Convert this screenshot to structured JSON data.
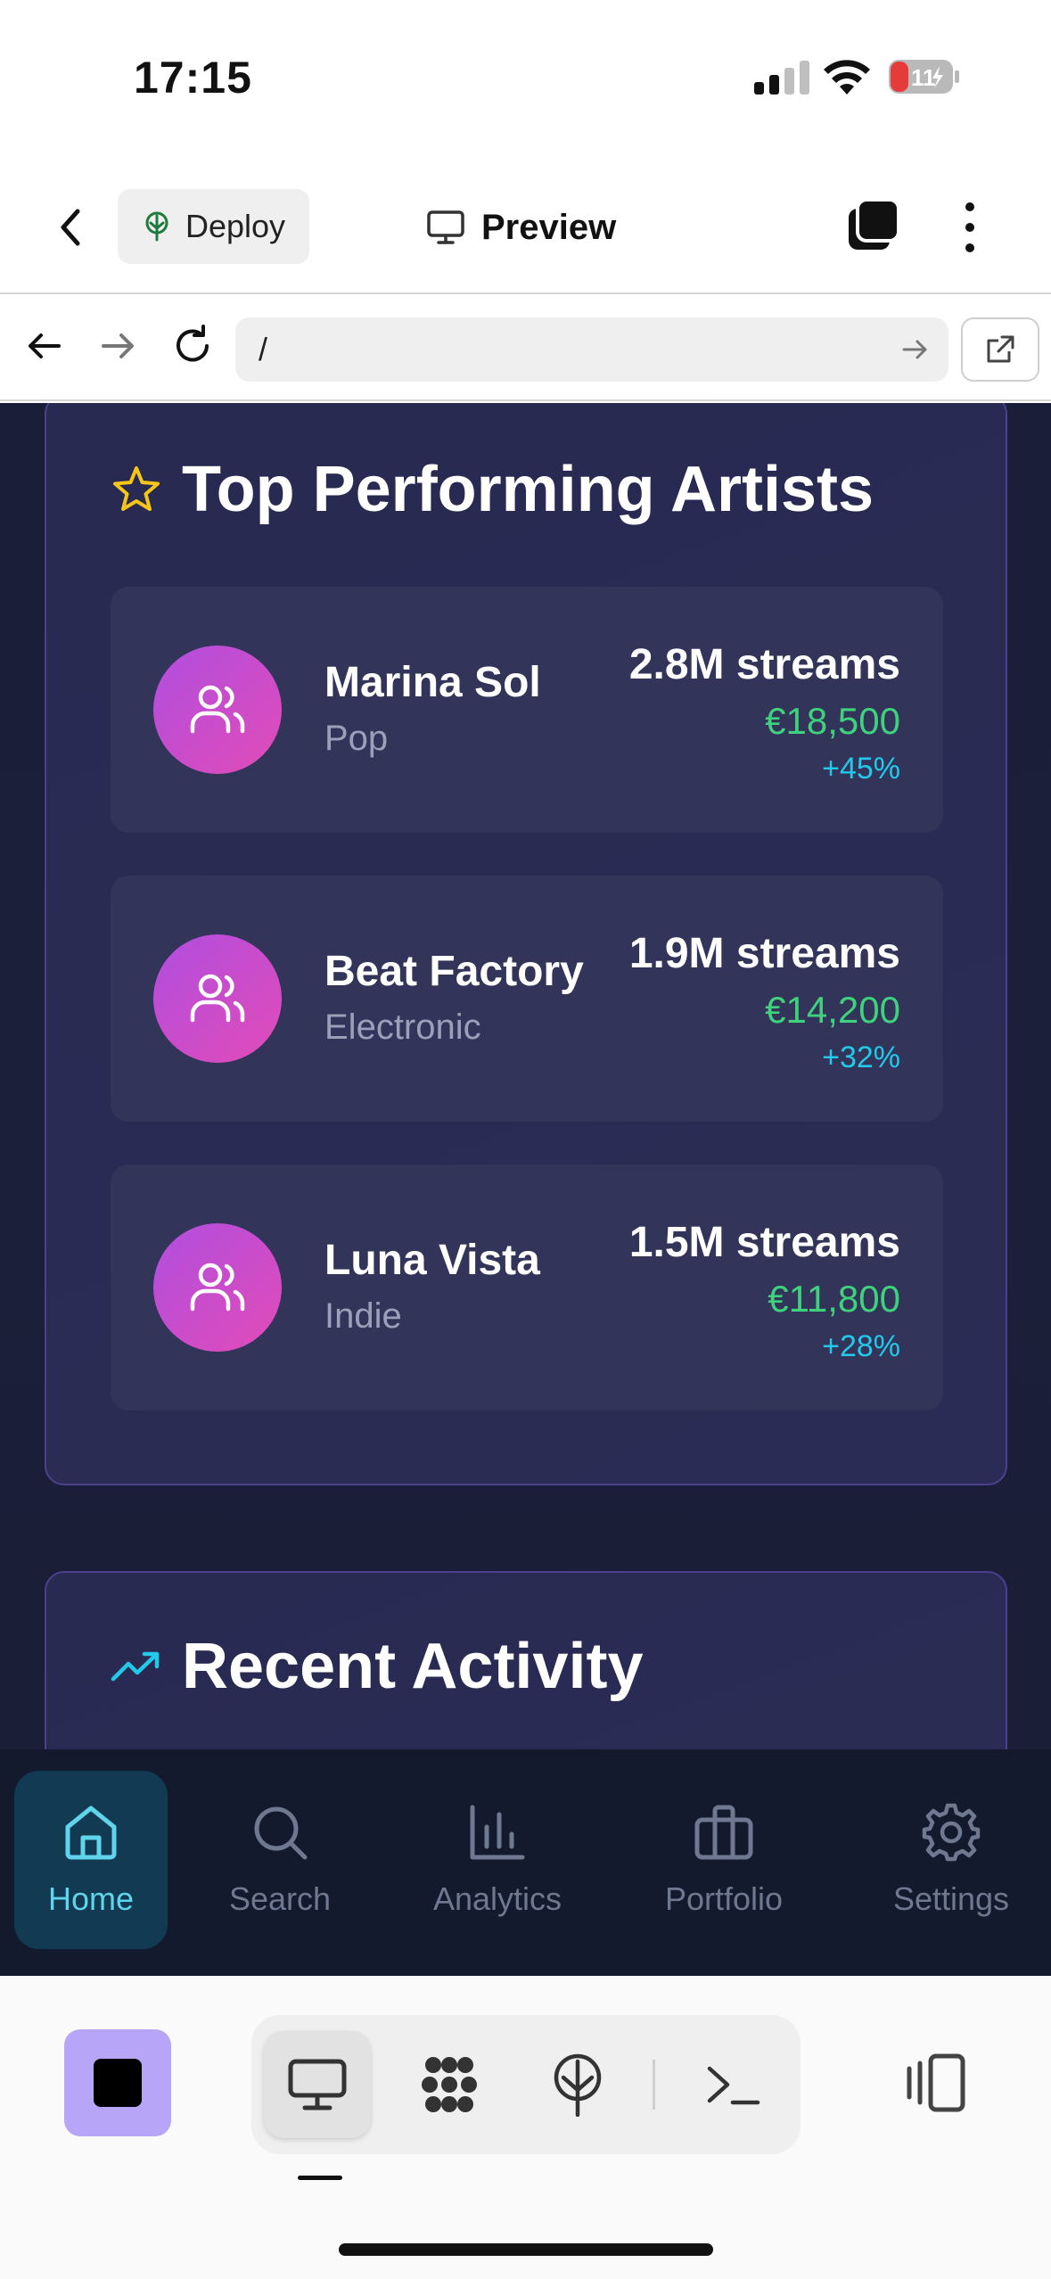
{
  "status_bar": {
    "time": "17:15",
    "battery": "11"
  },
  "app_bar": {
    "deploy_label": "Deploy",
    "preview_label": "Preview"
  },
  "browser": {
    "url": "/"
  },
  "top_artists": {
    "title": "Top Performing Artists",
    "artists": [
      {
        "name": "Marina Sol",
        "genre": "Pop",
        "streams": "2.8M streams",
        "revenue": "€18,500",
        "growth": "+45%"
      },
      {
        "name": "Beat Factory",
        "genre": "Electronic",
        "streams": "1.9M streams",
        "revenue": "€14,200",
        "growth": "+32%"
      },
      {
        "name": "Luna Vista",
        "genre": "Indie",
        "streams": "1.5M streams",
        "revenue": "€11,800",
        "growth": "+28%"
      }
    ]
  },
  "recent_activity": {
    "title": "Recent Activity"
  },
  "nav": {
    "items": [
      {
        "label": "Home",
        "icon": "home-icon",
        "active": true
      },
      {
        "label": "Search",
        "icon": "search-icon",
        "active": false
      },
      {
        "label": "Analytics",
        "icon": "bar-chart-icon",
        "active": false
      },
      {
        "label": "Portfolio",
        "icon": "briefcase-icon",
        "active": false
      },
      {
        "label": "Settings",
        "icon": "gear-icon",
        "active": false
      }
    ]
  },
  "colors": {
    "accent_cyan": "#5fd4ea",
    "star_yellow": "#f5c518",
    "revenue_green": "#3fd17c",
    "growth_cyan": "#22c9e8",
    "avatar_gradient_start": "#b04ee0",
    "avatar_gradient_end": "#e24bb7",
    "stop_button": "#b7a5f7"
  }
}
